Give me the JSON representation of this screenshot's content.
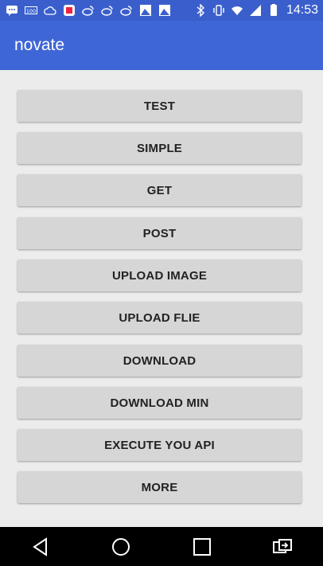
{
  "status_bar": {
    "time": "14:53",
    "left_icons": [
      "message-icon",
      "battery-100-icon",
      "cloud-icon",
      "app-icon",
      "weibo-icon",
      "weibo-icon",
      "weibo-icon",
      "image-icon",
      "image-icon"
    ],
    "right_icons": [
      "bluetooth-icon",
      "vibrate-icon",
      "wifi-icon",
      "signal-icon",
      "battery-icon"
    ],
    "battery_label": "100"
  },
  "app_bar": {
    "title": "novate"
  },
  "buttons": [
    {
      "label": "TEST"
    },
    {
      "label": "SIMPLE"
    },
    {
      "label": "GET"
    },
    {
      "label": "POST"
    },
    {
      "label": "UPLOAD IMAGE"
    },
    {
      "label": "UPLOAD FLIE"
    },
    {
      "label": "DOWNLOAD"
    },
    {
      "label": "DOWNLOAD MIN"
    },
    {
      "label": "EXECUTE YOU API"
    },
    {
      "label": "MORE"
    }
  ],
  "nav_bar": {
    "items": [
      "back-icon",
      "home-icon",
      "recents-icon",
      "screen-share-icon"
    ]
  },
  "colors": {
    "primary": "#3f66d6",
    "status_bar": "#3a5fcd",
    "background": "#ececec",
    "button": "#d6d6d6"
  }
}
